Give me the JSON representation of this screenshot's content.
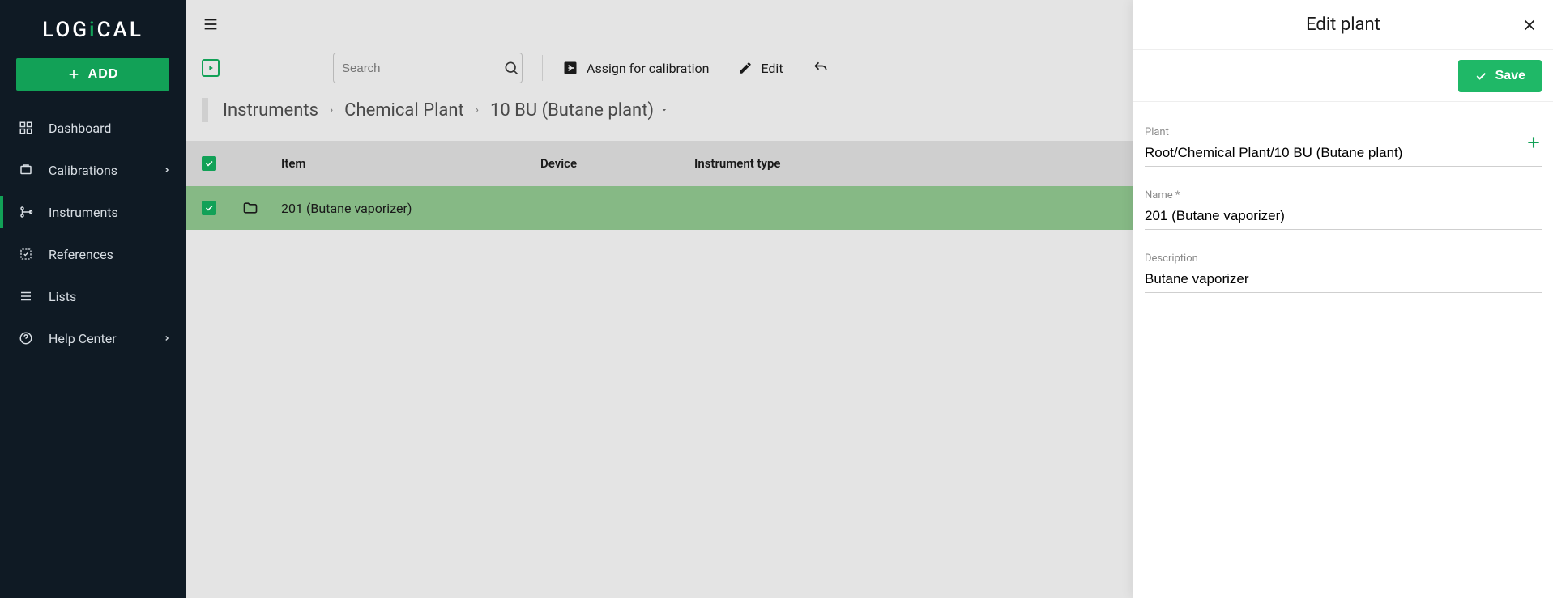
{
  "brand": {
    "pre": "LOG",
    "dot": "i",
    "post": "CAL"
  },
  "sidebar": {
    "add_label": "ADD",
    "items": [
      {
        "label": "Dashboard"
      },
      {
        "label": "Calibrations"
      },
      {
        "label": "Instruments"
      },
      {
        "label": "References"
      },
      {
        "label": "Lists"
      },
      {
        "label": "Help Center"
      }
    ]
  },
  "toolbar": {
    "search_placeholder": "Search",
    "assign_label": "Assign for calibration",
    "edit_label": "Edit"
  },
  "breadcrumb": {
    "root": "Instruments",
    "mid": "Chemical Plant",
    "last": "10 BU (Butane plant)"
  },
  "table": {
    "headers": {
      "item": "Item",
      "device": "Device",
      "type": "Instrument type"
    },
    "rows": [
      {
        "item": "201 (Butane vaporizer)",
        "device": "",
        "type": ""
      }
    ]
  },
  "panel": {
    "title": "Edit plant",
    "save_label": "Save",
    "fields": {
      "plant_label": "Plant",
      "plant_value": "Root/Chemical Plant/10 BU (Butane plant)",
      "name_label": "Name *",
      "name_value": "201 (Butane vaporizer)",
      "desc_label": "Description",
      "desc_value": "Butane vaporizer"
    }
  }
}
